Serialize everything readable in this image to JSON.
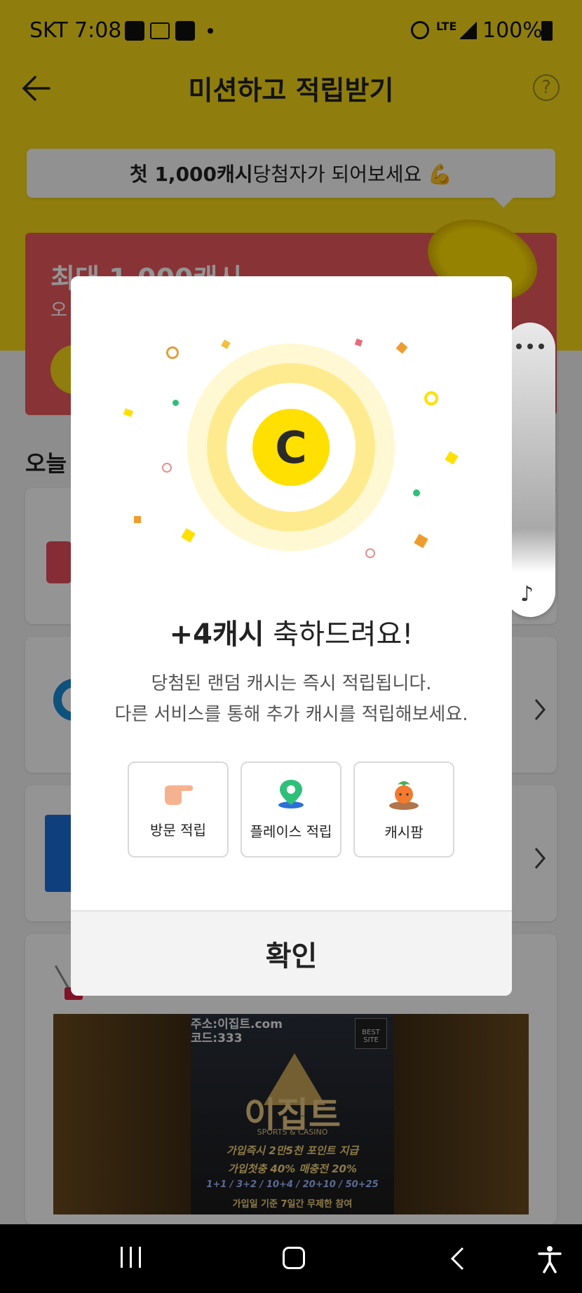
{
  "status_bar": {
    "carrier": "SKT",
    "time": "7:08",
    "network": "LTE",
    "battery": "100%"
  },
  "header": {
    "title": "미션하고 적립받기"
  },
  "banner": {
    "bold": "첫 1,000캐시",
    "rest": " 당첨자가 되어보세요 💪"
  },
  "promo": {
    "title": "최대 1,000캐시",
    "subtitle": "오"
  },
  "section": {
    "title": "오늘"
  },
  "modal": {
    "coin_symbol": "C",
    "headline_bold": "+4캐시",
    "headline_rest": " 축하드려요!",
    "desc_line1": "당첨된 랜덤 캐시는 즉시 적립됩니다.",
    "desc_line2": "다른 서비스를 통해 추가 캐시를 적립해보세요.",
    "options": [
      {
        "label": "방문 적립",
        "icon": "pointing-hand-icon"
      },
      {
        "label": "플레이스 적립",
        "icon": "location-pin-icon"
      },
      {
        "label": "캐시팜",
        "icon": "carrot-icon"
      }
    ],
    "confirm_label": "확인"
  },
  "ad": {
    "address": "주소:이집트.com",
    "code": "코드:333",
    "best_site": "BEST SITE",
    "brand": "이집트",
    "brand_sub": "SPORTS & CASINO",
    "line1": "가입즉시 2만5천 포인트 지급",
    "line2": "가입첫충 40% 매충전 20%",
    "line3": "1+1 / 3+2 / 10+4 / 20+10 / 50+25",
    "line4": "가입일 기준 7일간 무제한 참여"
  },
  "colors": {
    "brand_yellow": "#f7d917",
    "coin_yellow": "#ffe000",
    "promo_red": "#ea5a5f"
  }
}
